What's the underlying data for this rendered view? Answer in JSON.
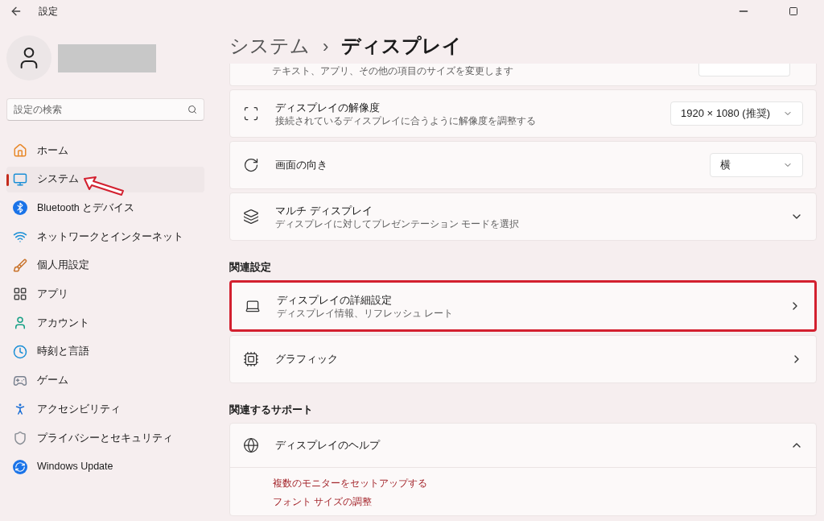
{
  "window": {
    "title": "設定"
  },
  "search": {
    "placeholder": "設定の検索"
  },
  "sidebar": {
    "items": [
      {
        "label": "ホーム",
        "selected": false
      },
      {
        "label": "システム",
        "selected": true
      },
      {
        "label": "Bluetooth とデバイス",
        "selected": false
      },
      {
        "label": "ネットワークとインターネット",
        "selected": false
      },
      {
        "label": "個人用設定",
        "selected": false
      },
      {
        "label": "アプリ",
        "selected": false
      },
      {
        "label": "アカウント",
        "selected": false
      },
      {
        "label": "時刻と言語",
        "selected": false
      },
      {
        "label": "ゲーム",
        "selected": false
      },
      {
        "label": "アクセシビリティ",
        "selected": false
      },
      {
        "label": "プライバシーとセキュリティ",
        "selected": false
      },
      {
        "label": "Windows Update",
        "selected": false
      }
    ]
  },
  "breadcrumb": {
    "parent": "システム",
    "separator": "›",
    "current": "ディスプレイ"
  },
  "top_rows": [
    {
      "kind": "partial",
      "subtitle": "テキスト、アプリ、その他の項目のサイズを変更します"
    },
    {
      "kind": "dropdown",
      "title": "ディスプレイの解像度",
      "subtitle": "接続されているディスプレイに合うように解像度を調整する",
      "value": "1920 × 1080 (推奨)"
    },
    {
      "kind": "dropdown",
      "title": "画面の向き",
      "value": "横"
    },
    {
      "kind": "expand",
      "title": "マルチ ディスプレイ",
      "subtitle": "ディスプレイに対してプレゼンテーション モードを選択",
      "expanded": false
    }
  ],
  "related": {
    "heading": "関連設定",
    "rows": [
      {
        "kind": "link",
        "title": "ディスプレイの詳細設定",
        "subtitle": "ディスプレイ情報、リフレッシュ レート",
        "highlighted": true
      },
      {
        "kind": "link",
        "title": "グラフィック",
        "highlighted": false
      }
    ]
  },
  "support": {
    "heading": "関連するサポート",
    "help": {
      "title": "ディスプレイのヘルプ",
      "expanded": true,
      "links": [
        "複数のモニターをセットアップする",
        "フォント サイズの調整"
      ]
    }
  }
}
